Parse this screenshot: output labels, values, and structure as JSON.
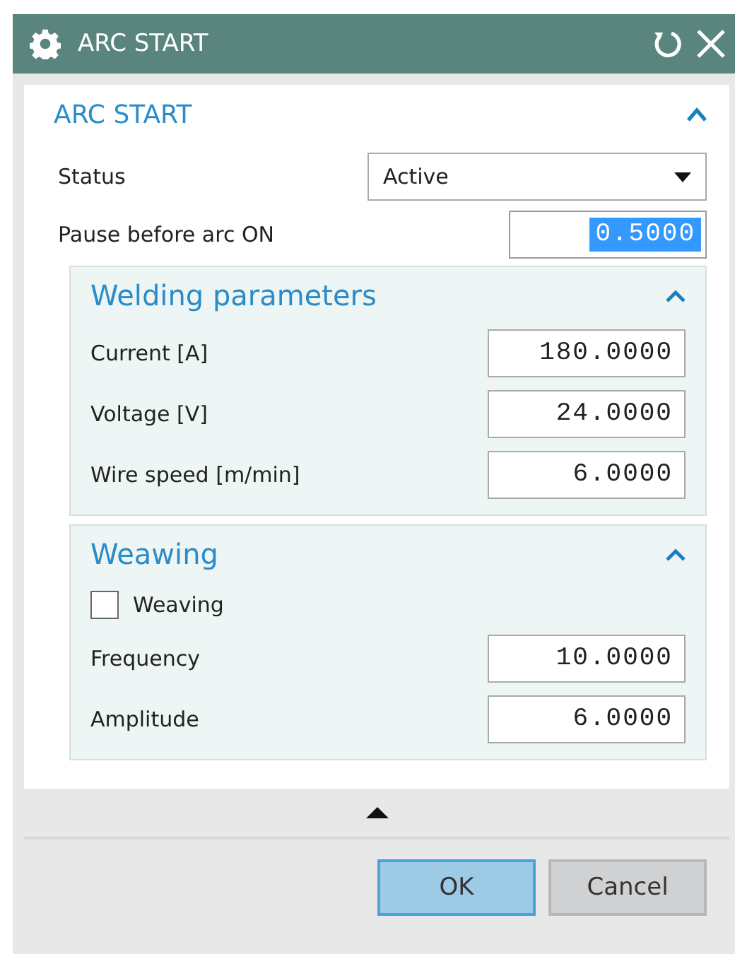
{
  "window": {
    "title": "ARC START"
  },
  "panel": {
    "title": "ARC START",
    "expanded": true,
    "status": {
      "label": "Status",
      "value": "Active"
    },
    "pause": {
      "label": "Pause before arc ON",
      "value": "0.5000",
      "highlighted": true
    },
    "groups": [
      {
        "title": "Welding parameters",
        "expanded": true,
        "items": [
          {
            "kind": "number",
            "label": "Current [A]",
            "value": "180.0000",
            "highlighted": false
          },
          {
            "kind": "number",
            "label": "Voltage [V]",
            "value": "24.0000",
            "highlighted": false
          },
          {
            "kind": "number",
            "label": "Wire speed [m/min]",
            "value": "6.0000",
            "highlighted": false
          }
        ]
      },
      {
        "title": "Weawing",
        "expanded": true,
        "items": [
          {
            "kind": "checkbox",
            "label": "Weaving",
            "checked": false
          },
          {
            "kind": "number",
            "label": "Frequency",
            "value": "10.0000",
            "highlighted": false
          },
          {
            "kind": "number",
            "label": "Amplitude",
            "value": "6.0000",
            "highlighted": false
          }
        ]
      }
    ]
  },
  "buttons": [
    {
      "label": "OK",
      "kind": "primary"
    },
    {
      "label": "Cancel",
      "kind": "secondary"
    }
  ]
}
